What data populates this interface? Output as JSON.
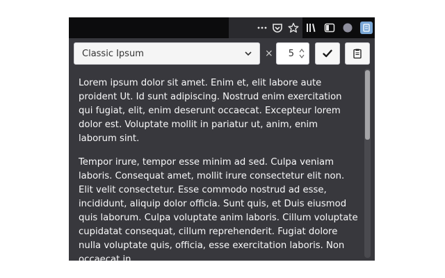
{
  "browser": {
    "toolbar_icons": [
      "more-horizontal-icon",
      "pocket-icon",
      "bookmark-star-icon",
      "library-icon",
      "sidebar-icon",
      "extension-circle-icon",
      "extension-active-icon"
    ],
    "colors": {
      "toolbar": "#0c0c0d",
      "urlbar": "#2a2a2e",
      "popup_bg": "#38383d"
    }
  },
  "popup": {
    "preset_select": {
      "value": "Classic Ipsum"
    },
    "multiply_symbol": "×",
    "paragraph_count": {
      "value": "5"
    },
    "generate_button_icon": "check-icon",
    "copy_button_icon": "clipboard-icon",
    "paragraphs": [
      "Lorem ipsum dolor sit amet. Enim et, elit labore aute proident Ut. Id sunt adipiscing. Nostrud enim exercitation qui fugiat, elit, enim deserunt occaecat. Excepteur lorem dolor est. Voluptate mollit in pariatur ut, anim, enim laborum sint.",
      "Tempor irure, tempor esse minim ad sed. Culpa veniam laboris. Consequat amet, mollit irure consectetur elit non. Elit velit consectetur. Esse commodo nostrud ad esse, incididunt, aliquip dolor officia. Sunt quis, et Duis eiusmod quis laborum. Culpa voluptate anim laboris. Cillum voluptate cupidatat consequat, cillum reprehenderit. Fugiat dolore nulla voluptate quis, officia, esse exercitation laboris. Non occaecat in."
    ]
  }
}
